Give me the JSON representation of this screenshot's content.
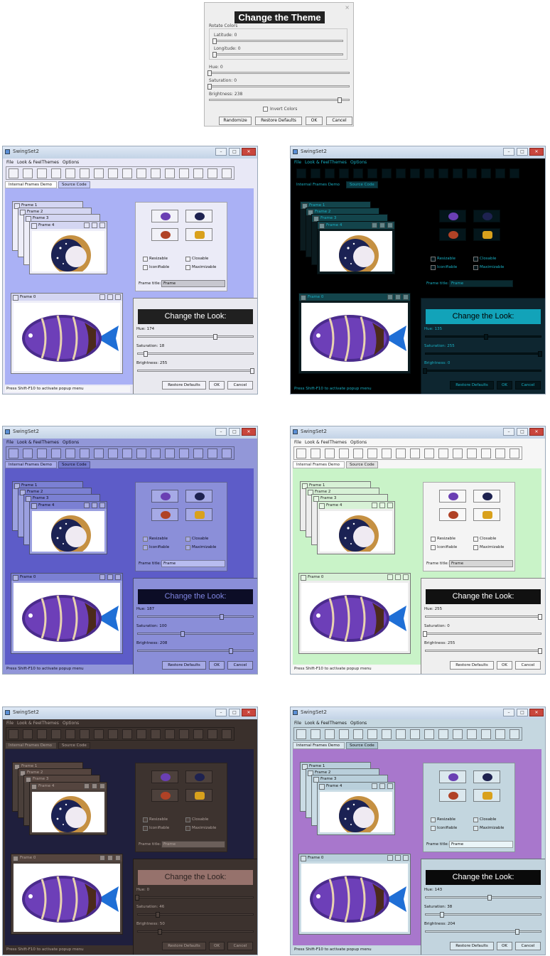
{
  "theme_dialog": {
    "title": "Change the Theme",
    "close_glyph": "×",
    "rotate_colors_label": "Rotate Colors",
    "latitude_label": "Latitude: 0",
    "longitude_label": "Longitude: 0",
    "hue_label": "Hue: 0",
    "saturation_label": "Saturation: 0",
    "brightness_label": "Brightness: 238",
    "invert_label": "Invert Colors",
    "latitude_value": 0,
    "longitude_value": 0,
    "hue_value": 0,
    "saturation_value": 0,
    "brightness_value": 238,
    "buttons": {
      "randomize": "Randomize",
      "restore": "Restore Defaults",
      "ok": "OK",
      "cancel": "Cancel"
    }
  },
  "common": {
    "app_title": "SwingSet2",
    "menu": [
      "File",
      "Look & Feel",
      "Themes",
      "Options"
    ],
    "tabs": [
      "Internal Frames Demo",
      "Source Code"
    ],
    "frames": [
      "Frame 1",
      "Frame 2",
      "Frame 3",
      "Frame 4",
      "Frame 0"
    ],
    "checkboxes": [
      "Resizable",
      "Closable",
      "Iconifiable",
      "Maximizable"
    ],
    "frame_title_label": "Frame title:",
    "frame_title_value": "Frame",
    "change_look_title": "Change the Look:",
    "restore_defaults": "Restore Defaults",
    "ok": "OK",
    "cancel": "Cancel",
    "status": "Press Shift-F10 to activate popup menu",
    "win_min": "–",
    "win_max": "□",
    "win_close": "✕"
  },
  "variants": [
    {
      "id": "light-lavender",
      "hue_label": "Hue: 174",
      "sat_label": "Saturation: 18",
      "bright_label": "Brightness: 255",
      "hue": 174,
      "sat": 18,
      "bright": 255,
      "colors": {
        "menubar": "#e8e8f6",
        "desk": "#aab1f5",
        "panel": "#ebebf7",
        "frame": "#eeeef9",
        "frame_title": "#d4d6f2",
        "dialog": "#e9e9ef",
        "title_bg": "#202020",
        "title_fg": "#ffffff",
        "text": "#111111",
        "button": "#f2f2f8",
        "tab": "#c6cbf6",
        "tab_active": "#ffffff",
        "input": "#c7c7cf",
        "status": "#f4f4f8"
      }
    },
    {
      "id": "dark-black-cyan",
      "hue_label": "Hue: 135",
      "sat_label": "Saturation: 255",
      "bright_label": "Brightness: 0",
      "hue": 135,
      "sat": 255,
      "bright": 0,
      "colors": {
        "menubar": "#000000",
        "desk": "#000000",
        "panel": "#000000",
        "frame": "#0b1b1f",
        "frame_title": "#13444b",
        "dialog": "#0e2630",
        "title_bg": "#12a3b9",
        "title_fg": "#000000",
        "text": "#19b0c4",
        "button": "#04161b",
        "tab": "#0c3a43",
        "tab_active": "#000000",
        "input": "#0a2a30",
        "status": "#000000"
      }
    },
    {
      "id": "blue-violet",
      "hue_label": "Hue: 187",
      "sat_label": "Saturation: 100",
      "bright_label": "Brightness: 208",
      "hue": 187,
      "sat": 100,
      "bright": 208,
      "colors": {
        "menubar": "#9297d8",
        "desk": "#5d5cc8",
        "panel": "#8b8fd9",
        "frame": "#9ba0e0",
        "frame_title": "#7b80d3",
        "dialog": "#8a8ed8",
        "title_bg": "#0c0d26",
        "title_fg": "#7f85e0",
        "text": "#0a0a1c",
        "button": "#a6aae6",
        "tab": "#777cd0",
        "tab_active": "#a9acec",
        "input": "#b8bcf0",
        "status": "#9296d9"
      }
    },
    {
      "id": "mint-green",
      "hue_label": "Hue: 255",
      "sat_label": "Saturation: 0",
      "bright_label": "Brightness: 255",
      "hue": 255,
      "sat": 0,
      "bright": 255,
      "colors": {
        "menubar": "#f6f6f6",
        "desk": "#c9f3c8",
        "panel": "#f4f4f4",
        "frame": "#ededed",
        "frame_title": "#d7f1d6",
        "dialog": "#efefef",
        "title_bg": "#111111",
        "title_fg": "#ffffff",
        "text": "#222222",
        "button": "#f8f8f8",
        "tab": "#e2e2e2",
        "tab_active": "#ffffff",
        "input": "#d6d6d6",
        "status": "#f7f7f7"
      }
    },
    {
      "id": "dark-brown",
      "hue_label": "Hue: 0",
      "sat_label": "Saturation: 46",
      "bright_label": "Brightness: 50",
      "hue": 0,
      "sat": 46,
      "bright": 50,
      "colors": {
        "menubar": "#3a302c",
        "desk": "#1f1f3d",
        "panel": "#3d332f",
        "frame": "#4a3f3a",
        "frame_title": "#55453f",
        "dialog": "#3c322e",
        "title_bg": "#96726c",
        "title_fg": "#2c2220",
        "text": "#b0a29c",
        "button": "#4d413c",
        "tab": "#3e3430",
        "tab_active": "#504540",
        "input": "#6b5f5a",
        "status": "#3a302c"
      }
    },
    {
      "id": "purple-steel",
      "hue_label": "Hue: 143",
      "sat_label": "Saturation: 38",
      "bright_label": "Brightness: 204",
      "hue": 143,
      "sat": 38,
      "bright": 204,
      "colors": {
        "menubar": "#c5d7e0",
        "desk": "#a877cc",
        "panel": "#c3d6df",
        "frame": "#cadce5",
        "frame_title": "#b9cfdb",
        "dialog": "#c2d4de",
        "title_bg": "#0a0a0a",
        "title_fg": "#ffffff",
        "text": "#111111",
        "button": "#dbe8ee",
        "tab": "#adc4d1",
        "tab_active": "#dbe7ee",
        "input": "#eaf5f8",
        "status": "#c8d9e2"
      }
    }
  ]
}
